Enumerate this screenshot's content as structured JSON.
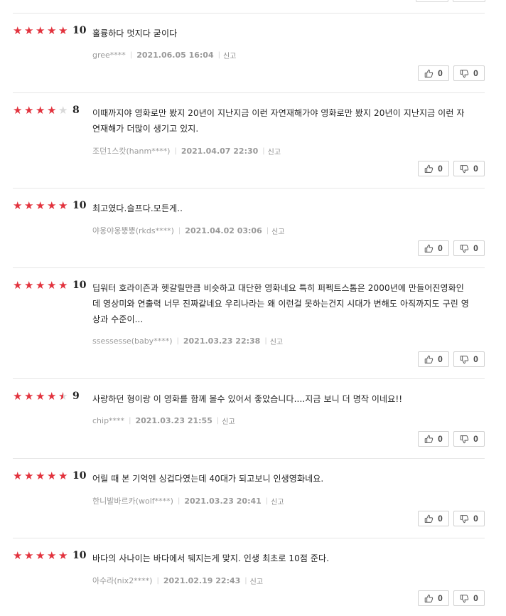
{
  "colors": {
    "star_active": "#e2323d",
    "star_inactive": "#d9d9d9"
  },
  "labels": {
    "report": "신고",
    "separator": "|"
  },
  "reviews": [
    {
      "score": "10",
      "stars": 5,
      "comment": "훌륭하다 멋지다 굳이다",
      "user": "gree****",
      "date": "2021.06.05 16:04",
      "likes": "0",
      "dislikes": "0"
    },
    {
      "score": "8",
      "stars": 4,
      "comment": "이때까지야 영화로만 봤지 20년이 지난지금 이런 자연재해가야 영화로만 봤지 20년이 지난지금 이런 자연재해가 더많이 생기고 있지.",
      "user": "조던1스캇(hanm****)",
      "date": "2021.04.07 22:30",
      "likes": "0",
      "dislikes": "0"
    },
    {
      "score": "10",
      "stars": 5,
      "comment": "최고였다.슬프다.모든게..",
      "user": "야옹야옹뿡뿡(rkds****)",
      "date": "2021.04.02 03:06",
      "likes": "0",
      "dislikes": "0"
    },
    {
      "score": "10",
      "stars": 5,
      "comment": "딥워터 호라이즌과 헷갈릴만큼 비슷하고 대단한 영화네요 특히 퍼펙트스톰은 2000년에 만들어진영화인데 영상미와 연출력 너무 진짜같네요 우리나라는 왜 이런걸 못하는건지 시대가 변해도 아직까지도 구린 영상과 수준이...",
      "user": "ssessesse(baby****)",
      "date": "2021.03.23 22:38",
      "likes": "0",
      "dislikes": "0"
    },
    {
      "score": "9",
      "stars": 4.5,
      "comment": "사랑하던 형이랑 이 영화를 함께 볼수 있어서 좋았습니다....지금 보니 더 명작 이네요!!",
      "user": "chip****",
      "date": "2021.03.23 21:55",
      "likes": "0",
      "dislikes": "0"
    },
    {
      "score": "10",
      "stars": 5,
      "comment": "어릴 때 본 기억엔 싱겁다였는데 40대가 되고보니 인생영화네요.",
      "user": "한니발바르카(wolf****)",
      "date": "2021.03.23 20:41",
      "likes": "0",
      "dislikes": "0"
    },
    {
      "score": "10",
      "stars": 5,
      "comment": "바다의 사나이는 바다에서 뒈지는게 맞지. 인생 최초로 10점 준다.",
      "user": "아수라(nix2****)",
      "date": "2021.02.19 22:43",
      "likes": "0",
      "dislikes": "0"
    }
  ]
}
